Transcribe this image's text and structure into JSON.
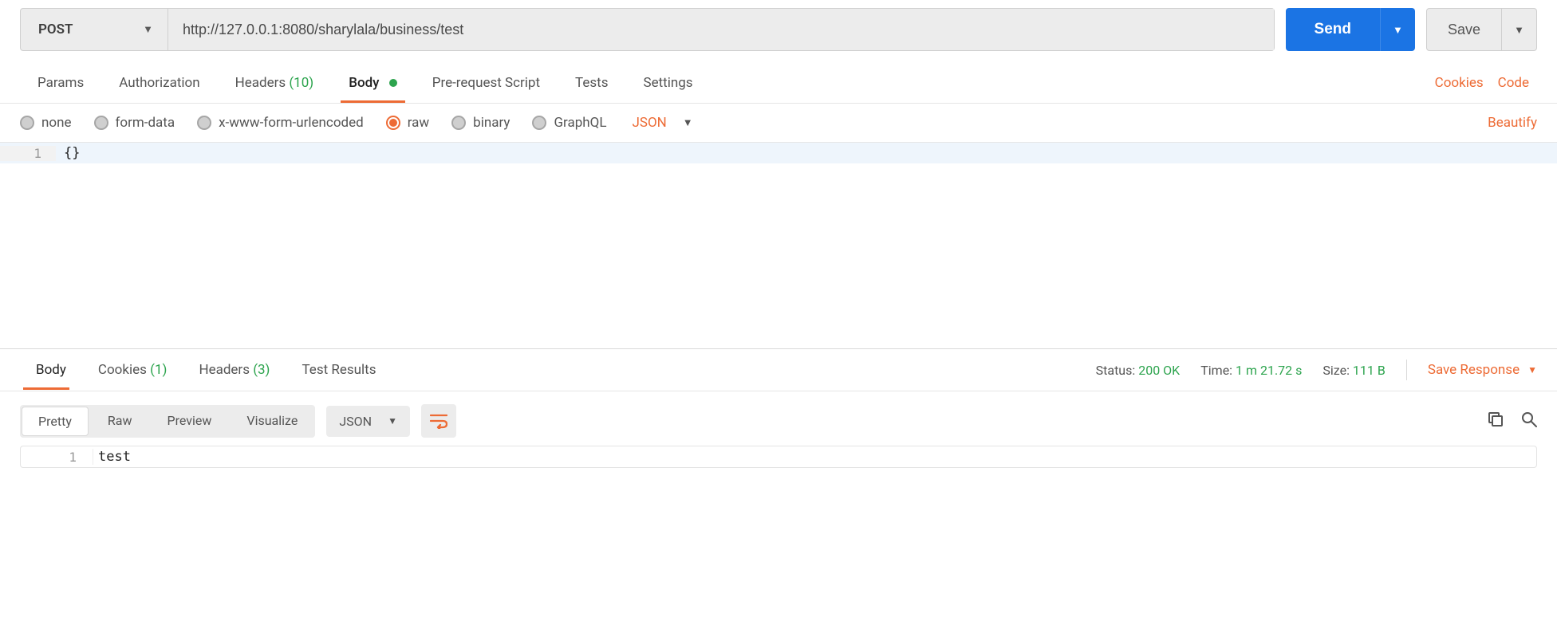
{
  "request": {
    "method": "POST",
    "url": "http://127.0.0.1:8080/sharylala/business/test",
    "send_label": "Send",
    "save_label": "Save"
  },
  "tabs": {
    "params": "Params",
    "authorization": "Authorization",
    "headers": "Headers",
    "headers_count": "(10)",
    "body": "Body",
    "prerequest": "Pre-request Script",
    "tests": "Tests",
    "settings": "Settings",
    "cookies_link": "Cookies",
    "code_link": "Code"
  },
  "body_options": {
    "none": "none",
    "formdata": "form-data",
    "xwww": "x-www-form-urlencoded",
    "raw": "raw",
    "binary": "binary",
    "graphql": "GraphQL",
    "language": "JSON",
    "beautify": "Beautify"
  },
  "request_body": {
    "line1_number": "1",
    "line1_content": "{}"
  },
  "response_tabs": {
    "body": "Body",
    "cookies": "Cookies",
    "cookies_count": "(1)",
    "headers": "Headers",
    "headers_count": "(3)",
    "test_results": "Test Results"
  },
  "response_meta": {
    "status_label": "Status:",
    "status_value": "200 OK",
    "time_label": "Time:",
    "time_value": "1 m 21.72 s",
    "size_label": "Size:",
    "size_value": "111 B",
    "save_response": "Save Response"
  },
  "response_view": {
    "pretty": "Pretty",
    "raw": "Raw",
    "preview": "Preview",
    "visualize": "Visualize",
    "language": "JSON"
  },
  "response_body": {
    "line1_number": "1",
    "line1_content": "test"
  }
}
